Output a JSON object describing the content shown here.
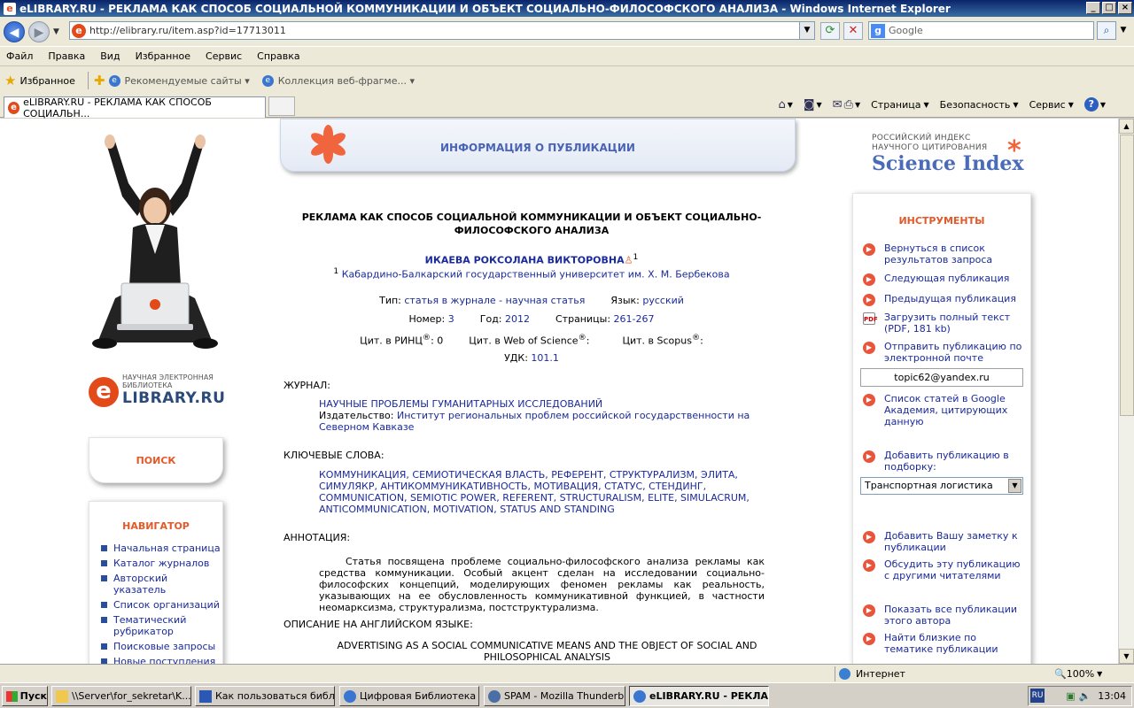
{
  "window": {
    "title": "eLIBRARY.RU - РЕКЛАМА КАК СПОСОБ СОЦИАЛЬНОЙ КОММУНИКАЦИИ И ОБЪЕКТ СОЦИАЛЬНО-ФИЛОСОФСКОГО АНАЛИЗА - Windows Internet Explorer"
  },
  "address": {
    "url": "http://elibrary.ru/item.asp?id=17713011"
  },
  "search": {
    "placeholder": "Google"
  },
  "menu": [
    "Файл",
    "Правка",
    "Вид",
    "Избранное",
    "Сервис",
    "Справка"
  ],
  "favorites": {
    "label": "Избранное",
    "links": [
      "Рекомендуемые сайты ▾",
      "Коллекция веб-фрагме... ▾"
    ]
  },
  "tab": {
    "title": "eLIBRARY.RU - РЕКЛАМА КАК СПОСОБ СОЦИАЛЬН..."
  },
  "commands": {
    "page": "Страница",
    "safety": "Безопасность",
    "tools": "Сервис"
  },
  "left": {
    "logo_small": "НАУЧНАЯ ЭЛЕКТРОННАЯ\nБИБЛИОТЕКА",
    "logo_big": "LIBRARY.RU",
    "search_label": "ПОИСК",
    "navigator_title": "НАВИГАТОР",
    "nav_items": [
      "Начальная страница",
      "Каталог журналов",
      "Авторский указатель",
      "Список организаций",
      "Тематический рубрикатор",
      "Поисковые запросы",
      "Новые поступления"
    ]
  },
  "header": {
    "title": "ИНФОРМАЦИЯ О ПУБЛИКАЦИИ"
  },
  "publication": {
    "title": "РЕКЛАМА КАК СПОСОБ СОЦИАЛЬНОЙ КОММУНИКАЦИИ И ОБЪЕКТ СОЦИАЛЬНО-ФИЛОСОФСКОГО АНАЛИЗА",
    "author": "ИКАЕВА РОКСОЛАНА ВИКТОРОВНА",
    "author_sup": "1",
    "affiliation_sup": "1",
    "affiliation": "Кабардино-Балкарский государственный университет им. Х. М. Бербекова",
    "type_label": "Тип:",
    "type_value": "статья в журнале - научная статья",
    "lang_label": "Язык:",
    "lang_value": "русский",
    "number_label": "Номер:",
    "number_value": "3",
    "year_label": "Год:",
    "year_value": "2012",
    "pages_label": "Страницы:",
    "pages_value": "261-267",
    "rinc_label": "Цит. в РИНЦ",
    "rinc_value": ": 0",
    "wos_label": "Цит. в Web of Science",
    "scopus_label": "Цит. в Scopus",
    "reg": "®",
    "udk_label": "УДК:",
    "udk_value": "101.1",
    "journal_label": "ЖУРНАЛ:",
    "journal_name": "НАУЧНЫЕ ПРОБЛЕМЫ ГУМАНИТАРНЫХ ИССЛЕДОВАНИЙ",
    "publisher_label": "Издательство:",
    "publisher_value": "Институт региональных проблем российской государственности на Северном Кавказе",
    "keywords_label": "КЛЮЧЕВЫЕ СЛОВА:",
    "keywords": "КОММУНИКАЦИЯ, СЕМИОТИЧЕСКАЯ ВЛАСТЬ, РЕФЕРЕНТ, СТРУКТУРАЛИЗМ, ЭЛИТА, СИМУЛЯКР, АНТИКОММУНИКАТИВНОСТЬ, МОТИВАЦИЯ, СТАТУС, СТЕНДИНГ, COMMUNICATION, SEMIOTIC POWER, REFERENT, STRUCTURALISM, ELITE, SIMULACRUM, ANTICOMMUNICATION, MOTIVATION, STATUS AND STANDING",
    "abstract_label": "АННОТАЦИЯ:",
    "abstract": "Статья посвящена проблеме социально-философского анализа рекламы как средства коммуникации. Особый акцент сделан на исследовании социально-философских концепций, моделирующих феномен рекламы как реальность, указывающих на ее обусловленность коммуникативной функцией, в частности неомарксизма, структурализма, постструктурализма.",
    "english_label": "ОПИСАНИЕ НА АНГЛИЙСКОМ ЯЗЫКЕ:",
    "english_title": "ADVERTISING AS A SOCIAL COMMUNICATIVE MEANS AND THE OBJECT OF SOCIAL AND PHILOSOPHICAL ANALYSIS"
  },
  "right": {
    "logo_small": "РОССИЙСКИЙ ИНДЕКС\nНАУЧНОГО ЦИТИРОВАНИЯ",
    "logo_big": "Science Index",
    "tools_title": "ИНСТРУМЕНТЫ",
    "tools": [
      "Вернуться в список результатов запроса",
      "Следующая публикация",
      "Предыдущая публикация",
      "Загрузить полный текст (PDF, 181 kb)",
      "Отправить публикацию по электронной почте",
      "Список статей в Google Академия, цитирующих данную",
      "Добавить публикацию в подборку:",
      "Добавить Вашу заметку к публикации",
      "Обсудить эту публикацию с другими читателями",
      "Показать все публикации этого автора",
      "Найти близкие по тематике публикации"
    ],
    "email_value": "topic62@yandex.ru",
    "collection_selected": "Транспортная логистика"
  },
  "status": {
    "zone": "Интернет",
    "zoom": "100%"
  },
  "taskbar": {
    "start": "Пуск",
    "tasks": [
      "\\\\Server\\for_sekretar\\K...",
      "Как пользоваться библ...",
      "Цифровая Библиотека ...",
      "SPAM - Mozilla Thunderbird",
      "eLIBRARY.RU - РЕКЛА..."
    ],
    "lang": "RU",
    "clock": "13:04"
  },
  "colors": {
    "accent_orange": "#e25a2a",
    "link_blue": "#1a2a9a",
    "header_blue": "#4a64b5"
  }
}
